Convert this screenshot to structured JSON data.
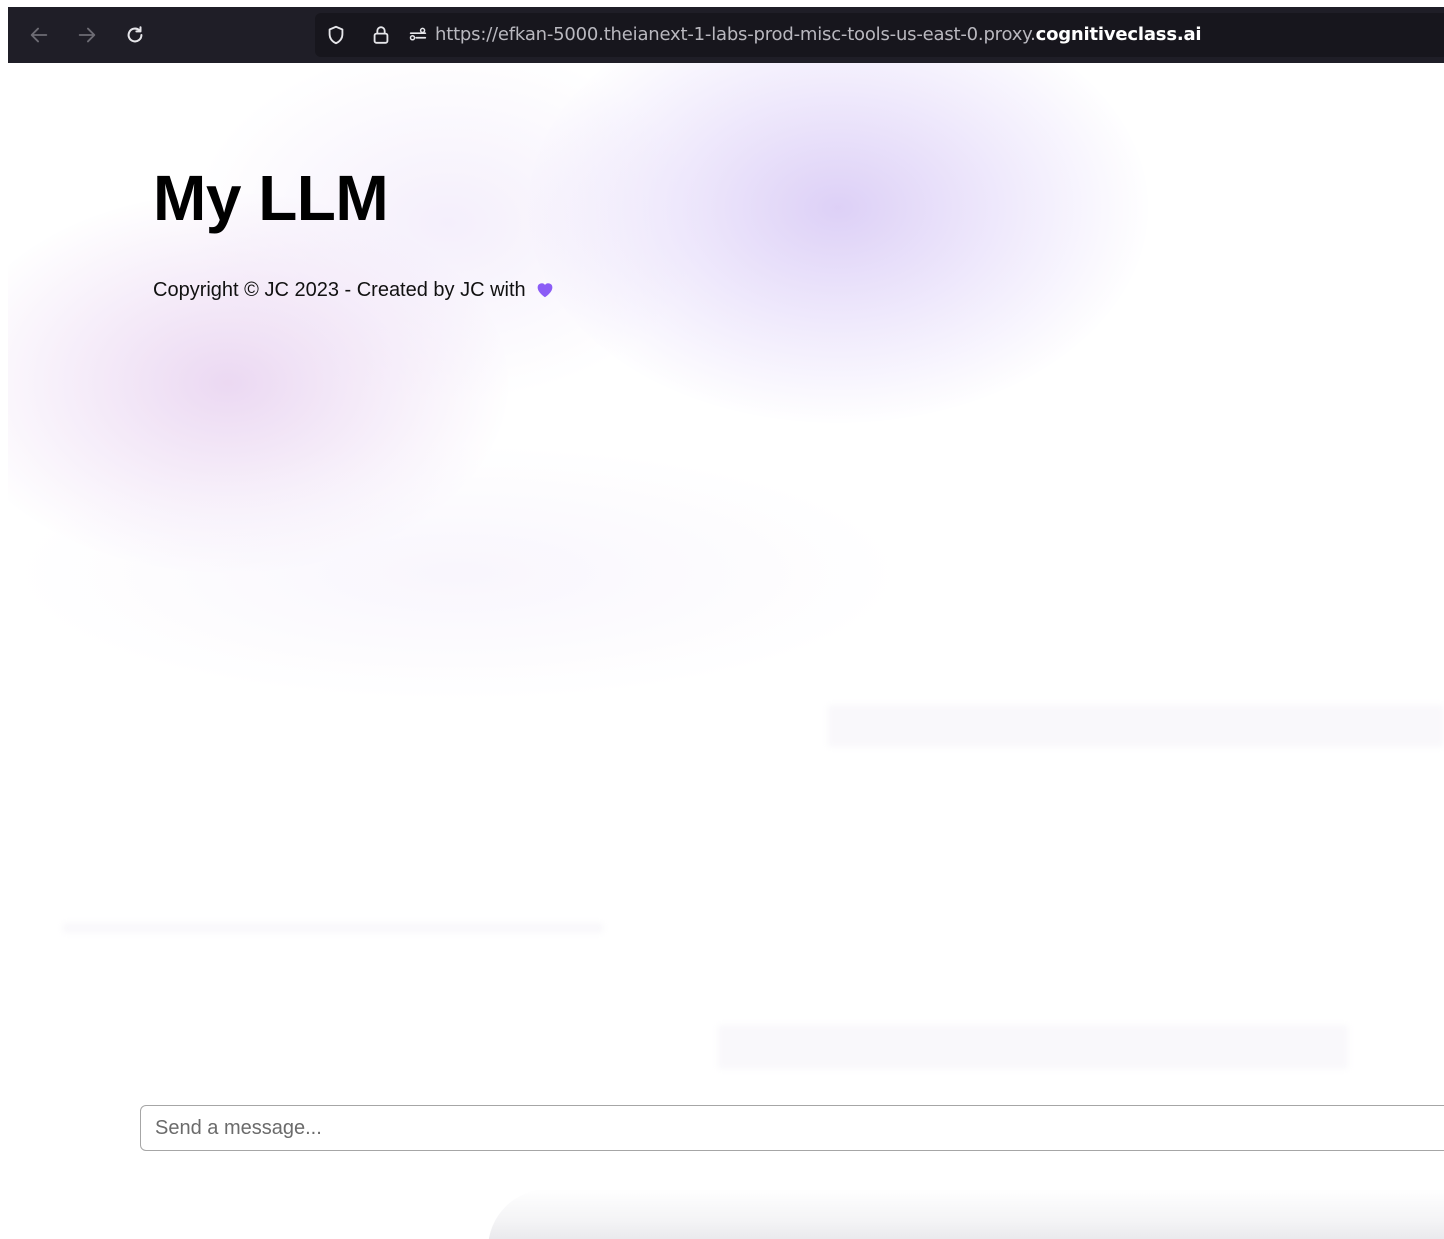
{
  "browser": {
    "url_prefix": "https://efkan-5000.theianext-1-labs-prod-misc-tools-us-east-0.proxy.",
    "url_domain": "cognitiveclass.ai",
    "icons": [
      "back-arrow-icon",
      "forward-arrow-icon",
      "reload-icon",
      "shield-icon",
      "lock-icon",
      "permissions-icon"
    ]
  },
  "page": {
    "title": "My LLM",
    "copyright": "Copyright © JC 2023 - Created by JC with",
    "heart_color": "#8b5cf6"
  },
  "chat": {
    "input_placeholder": "Send a message...",
    "input_value": ""
  }
}
